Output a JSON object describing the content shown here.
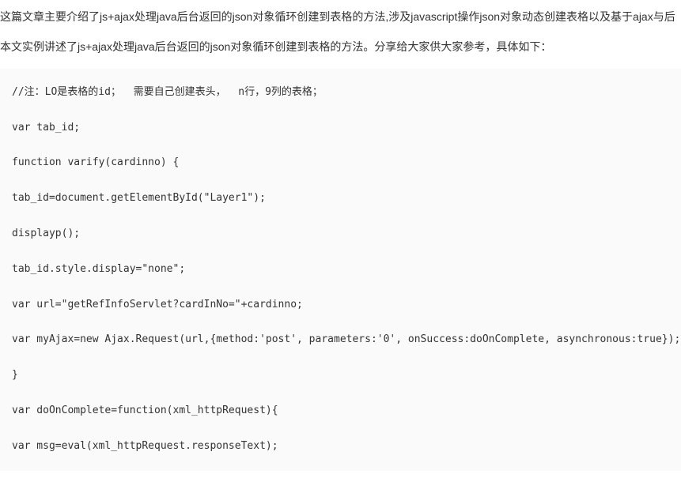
{
  "intro": "这篇文章主要介绍了js+ajax处理java后台返回的json对象循环创建到表格的方法,涉及javascript操作json对象动态创建表格以及基于ajax与后",
  "description": "本文实例讲述了js+ajax处理java后台返回的json对象循环创建到表格的方法。分享给大家供大家参考，具体如下：",
  "code": {
    "lines": [
      "//注：LO是表格的id；  需要自己创建表头，  n行，9列的表格；",
      "var tab_id;",
      "function varify(cardinno) {",
      "tab_id=document.getElementById(\"Layer1\");",
      "displayp();",
      "tab_id.style.display=\"none\";",
      "var url=\"getRefInfoServlet?cardInNo=\"+cardinno;",
      "var myAjax=new Ajax.Request(url,{method:'post', parameters:'0', onSuccess:doOnComplete, asynchronous:true});",
      "}",
      "var doOnComplete=function(xml_httpRequest){",
      "var msg=eval(xml_httpRequest.responseText);"
    ]
  }
}
